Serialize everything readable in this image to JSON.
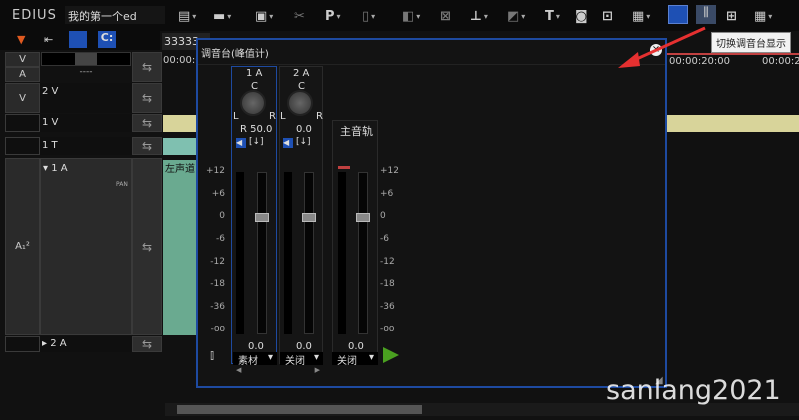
{
  "app": {
    "logo": "EDIUS",
    "project": "我的第一个ed"
  },
  "toolbar": {
    "icons": [
      "bin-icon",
      "open-folder-icon",
      "save-icon",
      "cut-icon",
      "p-icon",
      "clipboard-icon",
      "copy-icon",
      "delete-icon",
      "audio-level-icon",
      "transition-icon",
      "title-icon",
      "capture-icon",
      "voiceover-icon",
      "render-icon",
      "timeline-view-icon",
      "mixer-toggle-icon",
      "layout-icon",
      "keyboard-icon"
    ],
    "p_label": "P",
    "t_label": "T",
    "tooltip": "切换调音台显示"
  },
  "tracks": {
    "va_v": "V",
    "va_a": "A",
    "dash": "----",
    "rows": [
      {
        "patch": "V",
        "name": "2 V"
      },
      {
        "patch": "",
        "name": "1 V"
      },
      {
        "patch": "",
        "name": "1 T"
      },
      {
        "patch": "A₁²",
        "name": "▾ 1 A"
      },
      {
        "patch": "",
        "name": "▸ 2 A"
      }
    ],
    "pan_label": "PAN"
  },
  "timeline": {
    "timecode_box": "33333",
    "tc_left": "00:00:0",
    "tc_20": "00:00:20:00",
    "tc_24": "00:00:2",
    "clip_label": "左声道"
  },
  "mixer": {
    "title": "调音台(峰值计)",
    "scale": [
      "+12",
      "+6",
      "0",
      "-6",
      "-12",
      "-18",
      "-36",
      "-oo"
    ],
    "channels": [
      {
        "name": "1 A",
        "pan_c": "C",
        "pan_l": "L",
        "pan_r": "R",
        "pan_value": "R 50.0",
        "level": "0.0",
        "mode": "素材"
      },
      {
        "name": "2 A",
        "pan_c": "C",
        "pan_l": "L",
        "pan_r": "R",
        "pan_value": "0.0",
        "level": "0.0",
        "mode": "关闭"
      },
      {
        "name": "主音轨",
        "level": "0.0",
        "mode": "关闭"
      }
    ],
    "mute_label": "[↓]"
  },
  "watermark": "sanlang2021",
  "colors": {
    "accent": "#1e50b4",
    "arrow": "#e53030",
    "clip_yellow": "#d8d49a",
    "clip_teal": "#7fc0b0",
    "audio_clip": "#6aaa90"
  }
}
